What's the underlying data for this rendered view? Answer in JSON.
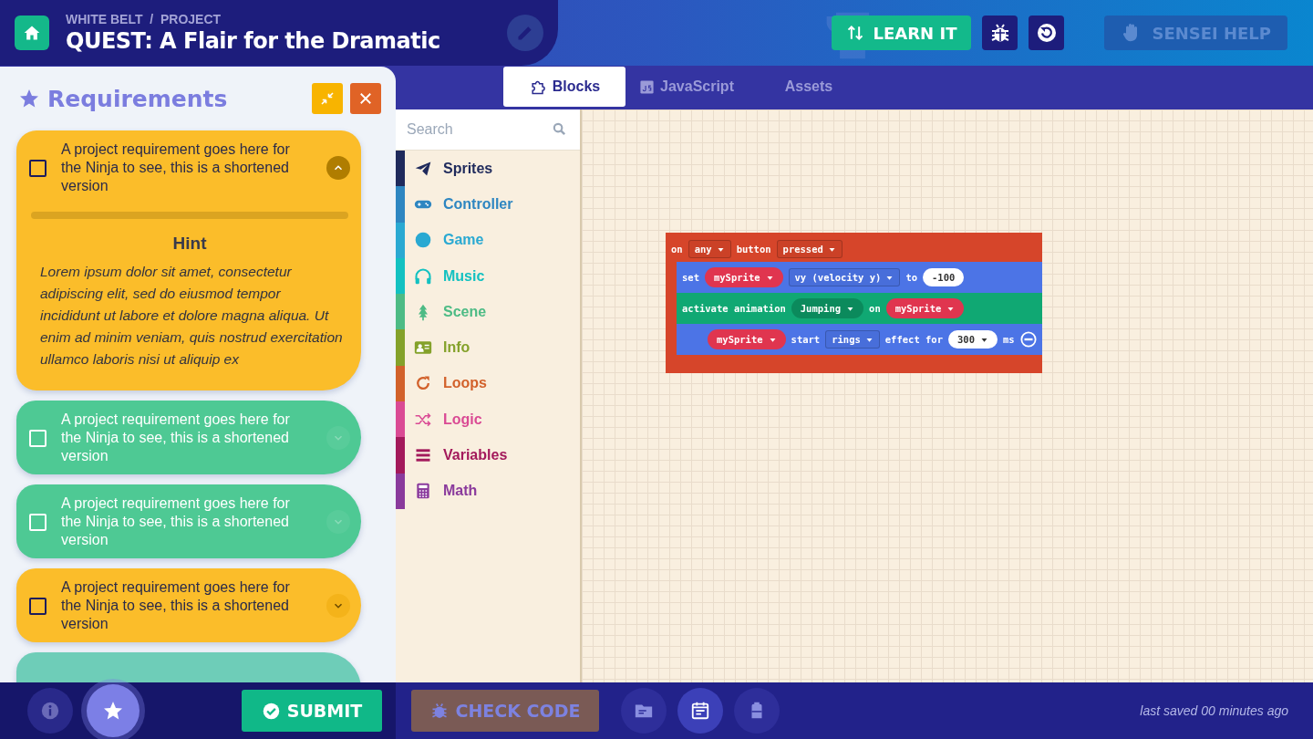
{
  "header": {
    "breadcrumb": "WHITE BELT  /  PROJECT",
    "title": "QUEST: A Flair for the Dramatic",
    "actions": [
      {
        "label": "LEARN IT",
        "kind": "primary"
      },
      {
        "kind": "bug"
      },
      {
        "kind": "reset"
      },
      {
        "label": "SENSEI HELP",
        "kind": "disabled"
      }
    ]
  },
  "requirements": {
    "title": "Requirements",
    "items": [
      {
        "text": "A project requirement goes here for the Ninja to see, this is a shortened version",
        "checked": false,
        "expanded": true,
        "color": "#fbbd2a",
        "hint_title": "Hint",
        "hint": "Lorem ipsum dolor sit amet, consectetur adipiscing elit, sed do eiusmod tempor incididunt ut labore et dolore magna aliqua. Ut enim ad minim veniam, quis nostrud exercitation ullamco laboris nisi ut aliquip ex"
      },
      {
        "text": "A project requirement goes here for the Ninja to see, this is a shortened version",
        "checked": false,
        "expanded": false,
        "color": "#4ec994"
      },
      {
        "text": "A project requirement goes here for the Ninja to see, this is a shortened version",
        "checked": false,
        "expanded": false,
        "color": "#4ec994"
      },
      {
        "text": "A project requirement goes here for the Ninja to see, this is a shortened version",
        "checked": false,
        "expanded": false,
        "color": "#fbbd2a"
      },
      {
        "color": "#6ecdb8"
      }
    ]
  },
  "tabs": [
    {
      "label": "Blocks",
      "selected": true,
      "kind": "blocks"
    },
    {
      "label": "JavaScript",
      "selected": false,
      "kind": "js"
    },
    {
      "label": "Assets",
      "selected": false,
      "kind": "assets"
    }
  ],
  "toolbox": {
    "placeholder": "Search",
    "categories": [
      {
        "label": "Sprites",
        "color": "#1f2a5c",
        "kind": "plane"
      },
      {
        "label": "Controller",
        "color": "#2e86c1",
        "kind": "gamepad"
      },
      {
        "label": "Game",
        "color": "#2aa9d2",
        "kind": "circle"
      },
      {
        "label": "Music",
        "color": "#13c1c1",
        "kind": "headphones"
      },
      {
        "label": "Scene",
        "color": "#4dbb85",
        "kind": "tree"
      },
      {
        "label": "Info",
        "color": "#84a12a",
        "kind": "card"
      },
      {
        "label": "Loops",
        "color": "#d2612b",
        "kind": "loop"
      },
      {
        "label": "Logic",
        "color": "#da4a94",
        "kind": "shuffle"
      },
      {
        "label": "Variables",
        "color": "#a3195b",
        "kind": "bars"
      },
      {
        "label": "Math",
        "color": "#8a3a9c",
        "kind": "calc"
      }
    ]
  },
  "program": {
    "color": "#d6452a",
    "parts": [
      {
        "kind": "label",
        "text": "on"
      },
      {
        "kind": "dropdown",
        "text": "any"
      },
      {
        "kind": "label",
        "text": "button"
      },
      {
        "kind": "dropdown",
        "text": "pressed"
      }
    ],
    "children": [
      {
        "color": "#4c74e6",
        "parts": [
          {
            "kind": "label",
            "text": "set"
          },
          {
            "kind": "variable",
            "text": "mySprite"
          },
          {
            "kind": "dropdown",
            "text": "vy (velocity y)"
          },
          {
            "kind": "label",
            "text": "to"
          },
          {
            "kind": "number",
            "text": "-100"
          }
        ]
      },
      {
        "color": "#10a873",
        "parts": [
          {
            "kind": "label",
            "text": "activate animation"
          },
          {
            "kind": "choice",
            "text": "Jumping"
          },
          {
            "kind": "label",
            "text": "on"
          },
          {
            "kind": "variable",
            "text": "mySprite"
          }
        ]
      },
      {
        "color": "#4c74e6",
        "parts": [
          {
            "kind": "variable",
            "text": "mySprite"
          },
          {
            "kind": "label",
            "text": "start"
          },
          {
            "kind": "dropdown",
            "text": "rings"
          },
          {
            "kind": "label",
            "text": "effect for"
          },
          {
            "kind": "numberdrop",
            "text": "300"
          },
          {
            "kind": "label",
            "text": "ms"
          },
          {
            "kind": "remove"
          }
        ]
      }
    ]
  },
  "footer": {
    "left": [
      {
        "kind": "info",
        "selected": false
      },
      {
        "kind": "star",
        "selected": true
      }
    ],
    "submit": "SUBMIT",
    "check": "CHECK CODE",
    "tools": [
      {
        "kind": "folder",
        "selected": false
      },
      {
        "kind": "calendar",
        "selected": true
      },
      {
        "kind": "backpack",
        "selected": false
      }
    ],
    "status": "last saved 00 minutes ago"
  }
}
